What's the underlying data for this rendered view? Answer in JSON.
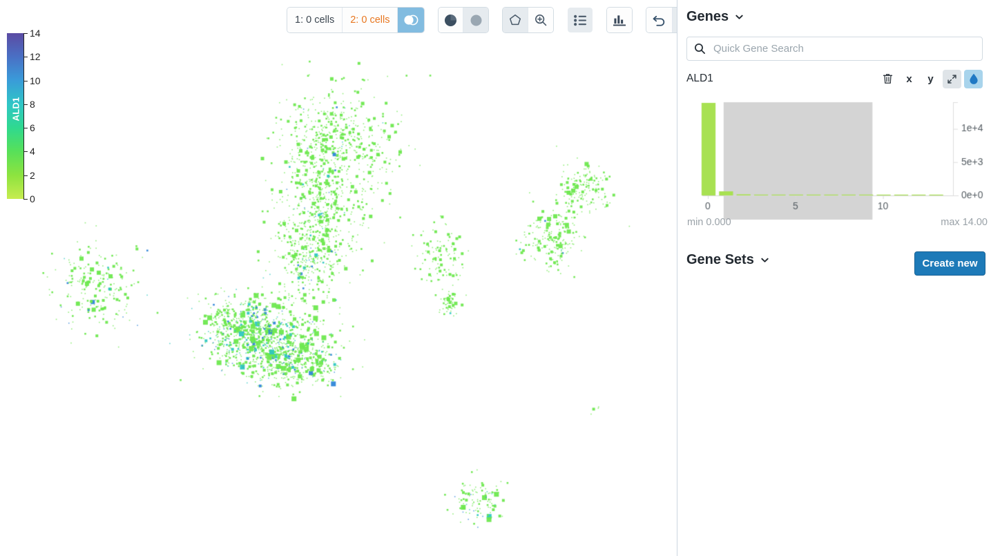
{
  "toolbar": {
    "selection_groups": [
      {
        "index": "1:",
        "label": "0 cells",
        "accent": "dark"
      },
      {
        "index": "2:",
        "label": "0 cells",
        "accent": "orange"
      }
    ],
    "venn_icon": "venn-diagram-icon",
    "pie_icon": "pie-chart-icon",
    "circle_icon": "filled-circle-icon",
    "lasso_icon": "lasso-select-icon",
    "zoom_icon": "zoom-in-icon",
    "list_icon": "list-view-icon",
    "bar_icon": "bar-chart-icon",
    "undo_icon": "undo-icon",
    "redo_icon": "redo-icon"
  },
  "legend": {
    "title": "ALD1",
    "ticks": [
      0,
      2,
      4,
      6,
      8,
      10,
      12,
      14
    ],
    "min": 0,
    "max": 14,
    "colors": [
      "#c7ec4f",
      "#8ee33f",
      "#56e05a",
      "#2fd98f",
      "#2fc6c6",
      "#3a9ad9",
      "#4a6fc4",
      "#5b4ba3"
    ]
  },
  "panel": {
    "genes_title": "Genes",
    "gene_sets_title": "Gene Sets",
    "create_new_label": "Create new",
    "accent_color": "#1d7ab8"
  },
  "search": {
    "placeholder": "Quick Gene Search",
    "value": "",
    "icon": "search-icon"
  },
  "gene": {
    "name": "ALD1",
    "actions": [
      {
        "name": "delete-gene-button",
        "glyph": "trash-icon",
        "state": "default"
      },
      {
        "name": "set-x-axis-button",
        "glyph": "x",
        "state": "default"
      },
      {
        "name": "set-y-axis-button",
        "glyph": "y",
        "state": "default"
      },
      {
        "name": "expand-gene-button",
        "glyph": "expand-arrows-icon",
        "state": "gray"
      },
      {
        "name": "colorby-gene-button",
        "glyph": "water-drop-icon",
        "state": "lightblue"
      }
    ],
    "min_label": "min 0.000",
    "max_label": "max 14.00"
  },
  "chart_data": {
    "type": "bar",
    "title": "ALD1",
    "xlabel": "",
    "ylabel": "",
    "xlim": [
      0,
      14
    ],
    "ylim": [
      0,
      14000
    ],
    "xticks": [
      0,
      5,
      10
    ],
    "xtick_labels": [
      "0",
      "5",
      "10"
    ],
    "yticks": [
      0,
      5000,
      10000
    ],
    "ytick_labels": [
      "0e+0",
      "5e+3",
      "1e+4"
    ],
    "grid": false,
    "legend": "none",
    "bar_color": "#a8e152",
    "brush": {
      "start": 0.9,
      "end": 9.4,
      "color": "#d4d4d4"
    },
    "categories": [
      0,
      1,
      2,
      3,
      4,
      5,
      6,
      7,
      8,
      9,
      10,
      11,
      12,
      13
    ],
    "values": [
      13900,
      620,
      170,
      110,
      60,
      25,
      12,
      8,
      5,
      3,
      2,
      1,
      1,
      1
    ]
  },
  "scatter": {
    "color_by": "ALD1",
    "point_color_low": "#6ee84f",
    "point_color_mid": "#2fc7c0",
    "point_color_high": "#2f86d8",
    "n_clusters": 6,
    "background": "#ffffff"
  }
}
